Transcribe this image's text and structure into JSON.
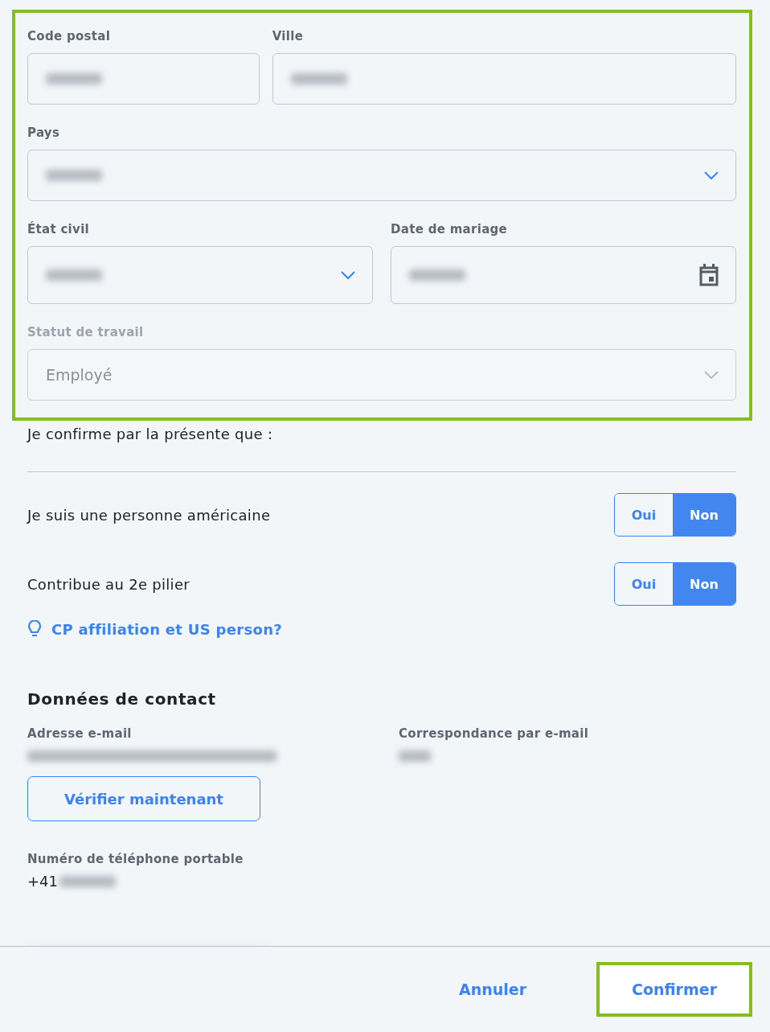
{
  "address_form": {
    "highlighted": true,
    "rows": [
      [
        {
          "label": "Code postal",
          "kind": "text",
          "redacted": true
        },
        {
          "label": "Ville",
          "kind": "text",
          "redacted": true
        }
      ],
      [
        {
          "label": "Pays",
          "kind": "select",
          "redacted": true,
          "disabled": false
        }
      ],
      [
        {
          "label": "État civil",
          "kind": "select",
          "redacted": true,
          "disabled": false
        },
        {
          "label": "Date de mariage",
          "kind": "date",
          "redacted": true,
          "disabled": false
        }
      ],
      [
        {
          "label": "Statut de travail",
          "kind": "select",
          "value": "Employé",
          "disabled": true
        }
      ]
    ]
  },
  "confirmation": {
    "intro": "Je confirme par la présente que :",
    "questions": [
      {
        "label": "Je suis une personne américaine",
        "options": [
          {
            "label": "Oui",
            "selected": false
          },
          {
            "label": "Non",
            "selected": true
          }
        ]
      },
      {
        "label": "Contribue au 2e pilier",
        "options": [
          {
            "label": "Oui",
            "selected": false
          },
          {
            "label": "Non",
            "selected": true
          }
        ]
      }
    ],
    "help_link": "CP affiliation et US person?"
  },
  "contact": {
    "title": "Données de contact",
    "email_label": "Adresse e-mail",
    "email_redacted": true,
    "verify_button": "Vérifier maintenant",
    "correspondence_label": "Correspondance par e-mail",
    "correspondence_redacted": true,
    "phone_label": "Numéro de téléphone portable",
    "phone_prefix": "+41",
    "phone_redacted": true
  },
  "footer": {
    "buttons": [
      {
        "label": "Annuler",
        "highlighted": false
      },
      {
        "label": "Confirmer",
        "highlighted": true
      }
    ]
  }
}
